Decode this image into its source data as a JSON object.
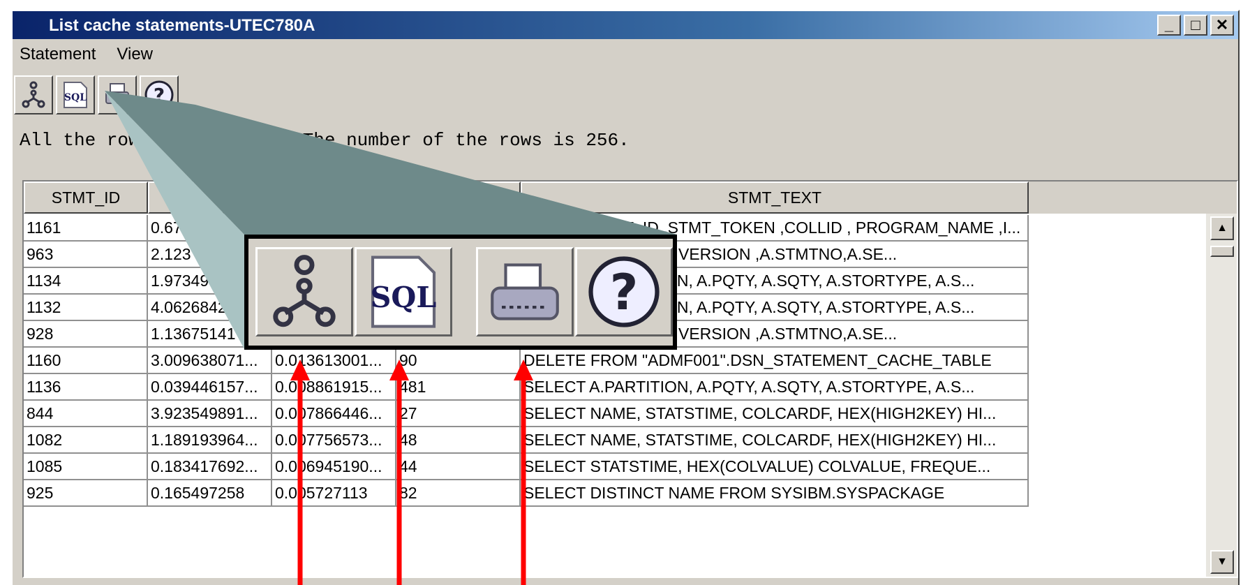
{
  "window": {
    "title": "List cache statements-UTEC780A",
    "controls": {
      "minimize": "_",
      "maximize": "□",
      "close": "✕"
    }
  },
  "menu": [
    "Statement",
    "View"
  ],
  "toolbar": {
    "buttons": [
      {
        "icon": "explain-icon"
      },
      {
        "icon": "sql-icon",
        "label": "SQL"
      },
      {
        "icon": "print-icon"
      },
      {
        "icon": "help-icon",
        "label": "?"
      }
    ]
  },
  "status": "All the rows are fetched. The number of the rows is 256.",
  "table": {
    "columns": [
      "STMT_ID",
      "",
      "",
      "STMT_TEXT"
    ],
    "rows": [
      [
        "1161",
        "0.67",
        "",
        "",
        "SELECT STMT_ID ,STMT_TOKEN ,COLLID , PROGRAM_NAME ,I..."
      ],
      [
        "963",
        "2.123",
        "",
        "",
        "SELECT A.NAME , A.VERSION ,A.STMTNO,A.SE..."
      ],
      [
        "1134",
        "1.97349",
        "",
        "",
        "SELECT A.PARTITION, A.PQTY, A.SQTY, A.STORTYPE, A.S..."
      ],
      [
        "1132",
        "4.0626842",
        "",
        "",
        "SELECT A.PARTITION, A.PQTY, A.SQTY, A.STORTYPE, A.S..."
      ],
      [
        "928",
        "1.13675141",
        "",
        "",
        "SELECT A.NAME , A.VERSION ,A.STMTNO,A.SE..."
      ],
      [
        "1160",
        "3.009638071...",
        "0.013613001...",
        "90",
        "DELETE FROM \"ADMF001\".DSN_STATEMENT_CACHE_TABLE"
      ],
      [
        "1136",
        "0.039446157...",
        "0.008861915...",
        "481",
        "SELECT A.PARTITION, A.PQTY, A.SQTY, A.STORTYPE, A.S..."
      ],
      [
        "844",
        "3.923549891...",
        "0.007866446...",
        "27",
        "SELECT NAME, STATSTIME, COLCARDF, HEX(HIGH2KEY) HI..."
      ],
      [
        "1082",
        "1.189193964...",
        "0.007756573...",
        "48",
        "SELECT NAME, STATSTIME, COLCARDF, HEX(HIGH2KEY) HI..."
      ],
      [
        "1085",
        "0.183417692...",
        "0.006945190...",
        "44",
        "SELECT STATSTIME, HEX(COLVALUE) COLVALUE, FREQUE..."
      ],
      [
        "925",
        "0.165497258",
        "0.005727113",
        "82",
        "SELECT DISTINCT NAME FROM SYSIBM.SYSPACKAGE"
      ]
    ]
  },
  "callout": {
    "colors": {
      "wedge": "#6e8a8a",
      "wedge_light": "#a9c3c3",
      "arrow": "#ff0000",
      "frame": "#000000"
    },
    "zoomed_buttons": [
      {
        "icon": "explain-icon"
      },
      {
        "icon": "sql-icon",
        "label": "SQL"
      },
      {
        "icon": "print-icon"
      },
      {
        "icon": "help-icon",
        "label": "?"
      }
    ]
  }
}
